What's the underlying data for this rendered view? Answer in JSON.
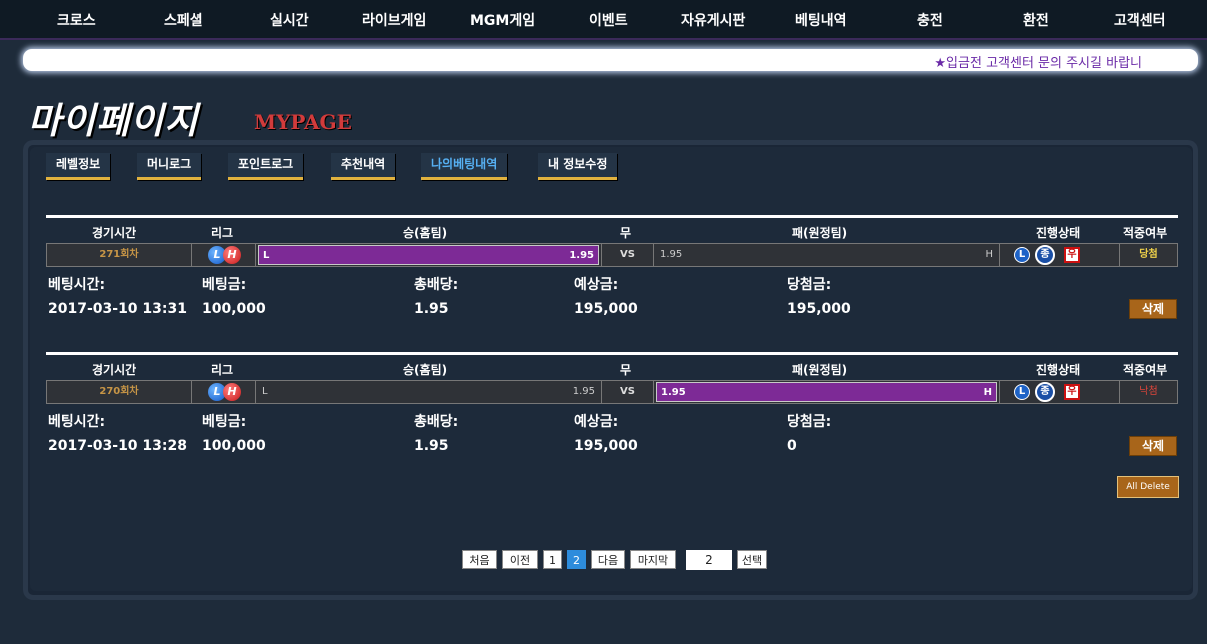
{
  "nav": {
    "items": [
      "크로스",
      "스페셜",
      "실시간",
      "라이브게임",
      "MGM게임",
      "이벤트",
      "자유게시판",
      "베팅내역",
      "충전",
      "환전",
      "고객센터"
    ]
  },
  "ticker": {
    "text": "★입금전 고객센터 문의 주시길 바랍니"
  },
  "page": {
    "title": "마이페이지",
    "subtitle": "MYPAGE"
  },
  "tabs": [
    "레벨정보",
    "머니로그",
    "포인트로그",
    "추천내역",
    "나의베팅내역",
    "내 정보수정"
  ],
  "table_headers": {
    "time": "경기시간",
    "league": "리그",
    "home": "승(홈팀)",
    "draw": "무",
    "away": "패(원정팀)",
    "status": "진행상태",
    "result": "적중여부"
  },
  "detail_labels": {
    "bet_time": "베팅시간:",
    "bet_amount": "베팅금:",
    "total_odds": "총배당:",
    "expected": "예상금:",
    "win_amount": "당첨금:"
  },
  "bets": [
    {
      "round": "271회차",
      "league_icons": [
        "L",
        "H"
      ],
      "home_label": "L",
      "home_odds": "1.95",
      "vs": "VS",
      "away_odds": "1.95",
      "away_label": "H",
      "selected": "home",
      "status_icons": [
        "L",
        "종",
        "우"
      ],
      "result": "당첨",
      "result_color": "#f0d24a",
      "bet_time": "2017-03-10 13:31",
      "bet_amount": "100,000",
      "total_odds": "1.95",
      "expected": "195,000",
      "win_amount": "195,000",
      "delete_label": "삭제"
    },
    {
      "round": "270회차",
      "league_icons": [
        "L",
        "H"
      ],
      "home_label": "L",
      "home_odds": "1.95",
      "vs": "VS",
      "away_odds": "1.95",
      "away_label": "H",
      "selected": "away",
      "status_icons": [
        "L",
        "종",
        "우"
      ],
      "result": "낙첨",
      "result_color": "#e0453a",
      "bet_time": "2017-03-10 13:28",
      "bet_amount": "100,000",
      "total_odds": "1.95",
      "expected": "195,000",
      "win_amount": "0",
      "delete_label": "삭제"
    }
  ],
  "all_delete_label": "All Delete",
  "pagination": {
    "first": "처음",
    "prev": "이전",
    "pages": [
      "1",
      "2"
    ],
    "current": "2",
    "next": "다음",
    "last": "마지막",
    "input_value": "2",
    "select": "선택"
  }
}
